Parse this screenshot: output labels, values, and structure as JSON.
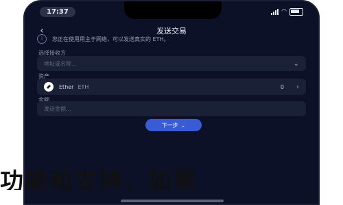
{
  "status_bar": {
    "time": "17:37"
  },
  "header": {
    "title": "发送交易"
  },
  "notice": {
    "text": "您正在使用用主于网络，可以发送真实的 ETH。"
  },
  "network": {
    "label": "选择接收方",
    "placeholder": "地址或名称..."
  },
  "asset": {
    "label": "资产",
    "name": "Ether",
    "symbol": "ETH",
    "balance": "0"
  },
  "amount": {
    "label": "金额",
    "placeholder": "发送金额..."
  },
  "next_button": {
    "label": "下一步"
  },
  "overlay": {
    "text": "功能和支持，如果"
  }
}
